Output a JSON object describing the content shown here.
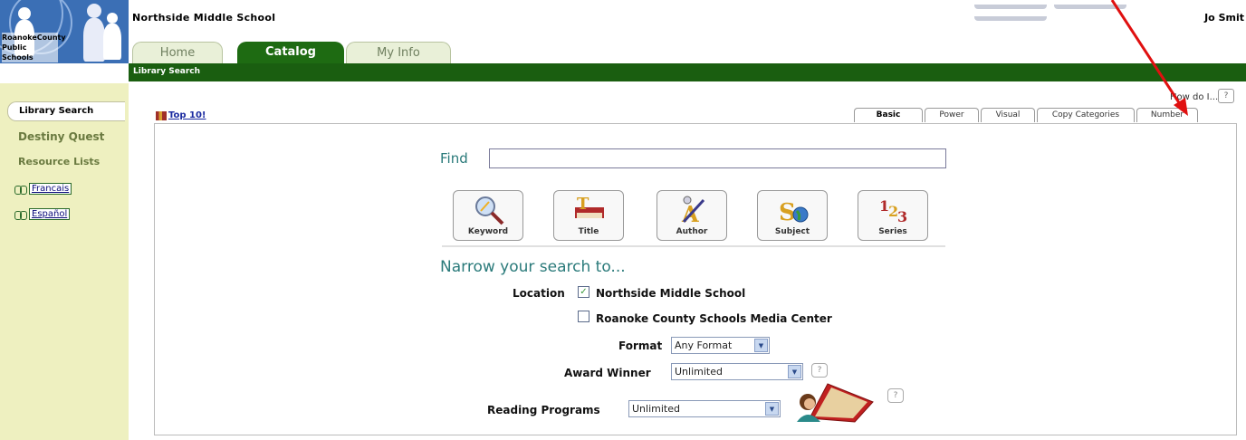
{
  "header": {
    "logo_text_line1": "RoanokeCounty",
    "logo_text_line2": "Public Schools",
    "school_name": "Northside Middle School",
    "user_name": "Jo Smit"
  },
  "tabs": [
    {
      "label": "Home",
      "active": false
    },
    {
      "label": "Catalog",
      "active": true
    },
    {
      "label": "My Info",
      "active": false
    }
  ],
  "subnav": {
    "label": "Library Search"
  },
  "sidebar": {
    "active_item": "Library Search",
    "items": [
      "Destiny Quest",
      "Resource Lists"
    ],
    "languages": [
      "Francais",
      "Español"
    ]
  },
  "help": {
    "label": "How do I...",
    "button": "?"
  },
  "top10": {
    "label": "Top 10!"
  },
  "search_tabs": [
    "Basic",
    "Power",
    "Visual",
    "Copy Categories",
    "Number"
  ],
  "find": {
    "label": "Find",
    "value": ""
  },
  "search_buttons": [
    {
      "label": "Keyword",
      "icon": "magnifier-icon"
    },
    {
      "label": "Title",
      "icon": "title-book-icon"
    },
    {
      "label": "Author",
      "icon": "author-pen-icon"
    },
    {
      "label": "Subject",
      "icon": "subject-globe-icon"
    },
    {
      "label": "Series",
      "icon": "series-123-icon"
    }
  ],
  "narrow": {
    "heading": "Narrow your search to...",
    "location_label": "Location",
    "locations": [
      {
        "label": "Northside Middle School",
        "checked": true
      },
      {
        "label": "Roanoke County Schools Media Center",
        "checked": false
      }
    ],
    "format_label": "Format",
    "format_value": "Any Format",
    "award_label": "Award Winner",
    "award_value": "Unlimited",
    "reading_label": "Reading Programs",
    "reading_value": "Unlimited",
    "help_button": "?"
  },
  "colors": {
    "brand_green": "#1a5e10",
    "sidebar_bg": "#eef0c0",
    "accent_teal": "#2a7a7a",
    "annotation_red": "#e01010"
  }
}
